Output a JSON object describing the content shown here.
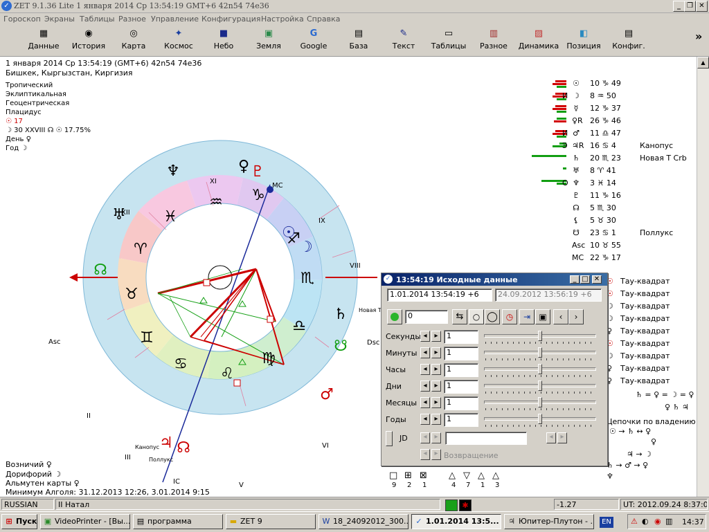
{
  "window": {
    "title": "ZET 9.1.36 Lite    1 января 2014  Ср  13:54:19 GMT+6 42n54  74e36",
    "app_icon": "zet-app-icon"
  },
  "menu": [
    "Гороскоп",
    "Экраны",
    "Таблицы",
    "Разное",
    "Управление",
    "Конфигурация",
    "Настройка",
    "Справка"
  ],
  "toolbar": [
    {
      "label": "Данные",
      "icon": "data-icon",
      "glyph": "▦"
    },
    {
      "label": "История",
      "icon": "history-icon",
      "glyph": "◉"
    },
    {
      "label": "Карта",
      "icon": "map-icon",
      "glyph": "◎"
    },
    {
      "label": "Космос",
      "icon": "cosmos-icon",
      "glyph": "✦"
    },
    {
      "label": "Небо",
      "icon": "sky-icon",
      "glyph": "■"
    },
    {
      "label": "Земля",
      "icon": "earth-icon",
      "glyph": "▣"
    },
    {
      "label": "Google",
      "icon": "google-icon",
      "glyph": "G"
    },
    {
      "label": "База",
      "icon": "database-icon",
      "glyph": "▤"
    },
    {
      "label": "Текст",
      "icon": "text-icon",
      "glyph": "✎"
    },
    {
      "label": "Таблицы",
      "icon": "tables-icon",
      "glyph": "▭"
    },
    {
      "label": "Разное",
      "icon": "misc-icon",
      "glyph": "▥"
    },
    {
      "label": "Динамика",
      "icon": "dynamics-icon",
      "glyph": "▨"
    },
    {
      "label": "Позиция",
      "icon": "position-icon",
      "glyph": "◧"
    },
    {
      "label": "Конфиг.",
      "icon": "config-icon",
      "glyph": "▤"
    }
  ],
  "header": {
    "date_line": "1 января 2014  Ср  13:54:19 (GMT+6) 42n54  74e36",
    "place": "Бишкек, Кыргызстан, Киргизия",
    "settings": [
      "Тропический",
      "Эклиптикальная",
      "Геоцентрическая",
      "Плацидус"
    ],
    "sun_line": "☉  17",
    "moon_line": "☽  30 XXVIII  ☊ ☉ 17.75%",
    "day": "День ♀",
    "year": "Год ☽"
  },
  "chart": {
    "house_labels": [
      "XI",
      "XII",
      "IX",
      "VIII",
      "II",
      "III",
      "VI",
      "V"
    ],
    "angle_labels": {
      "mc": "MC",
      "ic": "IC",
      "asc": "Asc",
      "dsc": "Dsc"
    },
    "zodiac": [
      "♑",
      "♒",
      "♓",
      "♈",
      "♉",
      "♊",
      "♋",
      "♌",
      "♍",
      "♎",
      "♏",
      "♐"
    ],
    "planets_outer": [
      "♆",
      "♅",
      "☊",
      "♀",
      "♇",
      "☉",
      "☽",
      "♄",
      "☋",
      "♂",
      "♃",
      "☊"
    ],
    "star_notes": [
      "Новая Т Crb",
      "Канопус",
      "Поллукс"
    ]
  },
  "planet_table": [
    {
      "bars": "red-red-green",
      "aspect": "",
      "glyph": "☉",
      "pos": "10 ♑ 49",
      "star": ""
    },
    {
      "bars": "red-red-green",
      "aspect": "И",
      "glyph": "☽",
      "pos": "8 ♒ 50",
      "star": ""
    },
    {
      "bars": "red-red-green",
      "aspect": "",
      "glyph": "☿",
      "pos": "12 ♑ 37",
      "star": ""
    },
    {
      "bars": "green-red",
      "aspect": "",
      "glyph": "♀R",
      "pos": "26 ♑ 46",
      "star": ""
    },
    {
      "bars": "red-red-green",
      "aspect": "И",
      "glyph": "♂",
      "pos": "11 ♎ 47",
      "star": ""
    },
    {
      "bars": "green-green",
      "aspect": "Э",
      "glyph": "♃R",
      "pos": "16 ♋ 4",
      "star": "Канопус"
    },
    {
      "bars": "green-long",
      "aspect": "",
      "glyph": "♄",
      "pos": "20 ♏ 23",
      "star": "Новая Т Crb"
    },
    {
      "bars": "green-dot",
      "aspect": "",
      "glyph": "♅",
      "pos": "8 ♈ 41",
      "star": ""
    },
    {
      "bars": "green-long2",
      "aspect": "О",
      "glyph": "♆",
      "pos": "3 ♓ 14",
      "star": ""
    },
    {
      "bars": "",
      "aspect": "",
      "glyph": "♇",
      "pos": "11 ♑ 16",
      "star": ""
    },
    {
      "bars": "",
      "aspect": "",
      "glyph": "☊",
      "pos": "5 ♏ 30",
      "star": ""
    },
    {
      "bars": "",
      "aspect": "",
      "glyph": "⚸",
      "pos": "5 ♉ 30",
      "star": ""
    },
    {
      "bars": "",
      "aspect": "",
      "glyph": "☋",
      "pos": "23 ♋ 1",
      "star": "Поллукс"
    },
    {
      "bars": "",
      "aspect": "",
      "glyph": "Asc",
      "pos": "10 ♉ 55",
      "star": ""
    },
    {
      "bars": "",
      "aspect": "",
      "glyph": "MC",
      "pos": "22 ♑ 17",
      "star": ""
    }
  ],
  "aspects_right": [
    {
      "glyph": "☉",
      "text": "Тау-квадрат"
    },
    {
      "glyph": "☉",
      "text": "Тау-квадрат"
    },
    {
      "glyph": "☽",
      "text": "Тау-квадрат"
    },
    {
      "glyph": "☽",
      "text": "Тау-квадрат"
    },
    {
      "glyph": "♀",
      "text": "Тау-квадрат"
    },
    {
      "glyph": "☉",
      "text": "Тау-квадрат"
    },
    {
      "glyph": "☽",
      "text": "Тау-квадрат"
    },
    {
      "glyph": "♀",
      "text": "Тау-квадрат"
    },
    {
      "glyph": "♀",
      "text": "Тау-квадрат"
    }
  ],
  "rulership": {
    "formula1": "♄ = ♀ = ☽ = ♀",
    "formula2": "♀ ♄ ♃",
    "title": "Цепочки по владению",
    "chain1": "☉ → ♄ ↔ ♀",
    "chain2": "♀",
    "chain3": "♃ → ☽",
    "chain4": "♄ → ♂ → ♀"
  },
  "bottom_left": {
    "line1": "Возничий  ♀",
    "line2": "Дорифорий  ☽",
    "line3": "Альмутен карты  ♀",
    "line4": "Минимум Алголя: 31.12.2013 12:26,  3.01.2014  9:15"
  },
  "legend": {
    "symbols1": [
      "□",
      "⊞",
      "⊠"
    ],
    "counts1": [
      "9",
      "2",
      "1"
    ],
    "symbols2": [
      "△",
      "▽",
      "△",
      "△"
    ],
    "counts2": [
      "4",
      "7",
      "1",
      "3"
    ]
  },
  "dialog": {
    "title": "13:54:19 Исходные данные",
    "datetime_value": "1.01.2014  13:54:19  +6",
    "datetime_ref": "24.09.2012   13:56:19  +6",
    "counter_value": "0",
    "rows": [
      {
        "label": "Секунды",
        "value": "1"
      },
      {
        "label": "Минуты",
        "value": "1"
      },
      {
        "label": "Часы",
        "value": "1"
      },
      {
        "label": "Дни",
        "value": "1"
      },
      {
        "label": "Месяцы",
        "value": "1"
      },
      {
        "label": "Годы",
        "value": "1"
      }
    ],
    "jd_label": "JD",
    "return_label": "Возвращение"
  },
  "statusbar": {
    "lang": "RUSSIAN",
    "mode": "II Натал",
    "value": "-1.27",
    "ut": "UT: 2012.09.24  8:37:04"
  },
  "taskbar": {
    "start": "Пуск",
    "tasks": [
      "VideoPrinter - [Вы...",
      "программа",
      "ZET 9",
      "18_24092012_300...",
      "1.01.2014  13:5...",
      "Юпитер-Плутон - ..."
    ],
    "lang": "EN",
    "clock": "14:37"
  },
  "colors": {
    "red": "#d10000",
    "green": "#129e12",
    "dialog_title": "#0a246a"
  }
}
